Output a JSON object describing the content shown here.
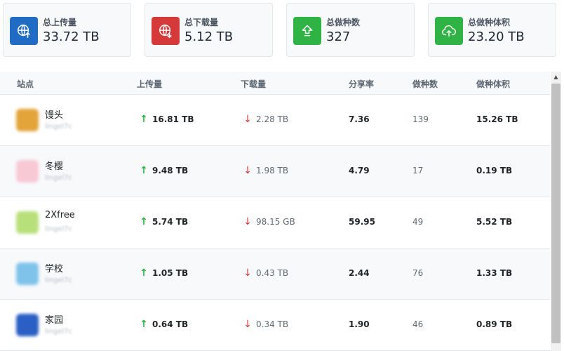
{
  "stats": [
    {
      "label": "总上传量",
      "value": "33.72 TB",
      "color": "#206bc4",
      "icon": "globe-upload-icon"
    },
    {
      "label": "总下载量",
      "value": "5.12 TB",
      "color": "#d63939",
      "icon": "globe-download-icon"
    },
    {
      "label": "总做种数",
      "value": "327",
      "color": "#2fb344",
      "icon": "seed-upload-icon"
    },
    {
      "label": "总做种体积",
      "value": "23.20 TB",
      "color": "#2fb344",
      "icon": "cloud-upload-icon"
    }
  ],
  "table": {
    "headers": {
      "site": "站点",
      "upload": "上传量",
      "download": "下载量",
      "ratio": "分享率",
      "seeds": "做种数",
      "seed_size": "做种体积"
    },
    "rows": [
      {
        "name": "馒头",
        "user": "lingel7c",
        "upload": "16.81 TB",
        "download": "2.28 TB",
        "ratio": "7.36",
        "seeds": "139",
        "seed_size": "15.26 TB",
        "logo_color": "#e3a43a"
      },
      {
        "name": "冬樱",
        "user": "lingel7c",
        "upload": "9.48 TB",
        "download": "1.98 TB",
        "ratio": "4.79",
        "seeds": "17",
        "seed_size": "0.19 TB",
        "logo_color": "#f7c9d4"
      },
      {
        "name": "2Xfree",
        "user": "lingel7c",
        "upload": "5.74 TB",
        "download": "98.15 GB",
        "ratio": "59.95",
        "seeds": "49",
        "seed_size": "5.52 TB",
        "logo_color": "#b8e07a"
      },
      {
        "name": "学校",
        "user": "lingel7c",
        "upload": "1.05 TB",
        "download": "0.43 TB",
        "ratio": "2.44",
        "seeds": "76",
        "seed_size": "1.33 TB",
        "logo_color": "#7fc3ea"
      },
      {
        "name": "家园",
        "user": "lingel7c",
        "upload": "0.64 TB",
        "download": "0.34 TB",
        "ratio": "1.90",
        "seeds": "46",
        "seed_size": "0.89 TB",
        "logo_color": "#2b5fc4"
      }
    ]
  },
  "glyphs": {
    "up": "↑",
    "down": "↓",
    "scroll_up": "▲"
  }
}
